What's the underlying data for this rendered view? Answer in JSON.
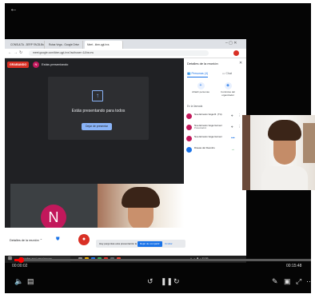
{
  "player": {
    "back_icon": "arrow-back-icon",
    "time_current": "00:00:02",
    "time_total": "00:15:48",
    "progress_fraction": 0.002
  },
  "browser": {
    "tabs": [
      {
        "label": "CONSULTA - 3ERP FACB-Brand.c"
      },
      {
        "label": "Rutas Vega - Google Drive"
      },
      {
        "label": "Meet - kbm-qgt-hvs"
      }
    ],
    "address": "meet.google.com/kbm-qgt-hvs?authuser=1&hs=rw"
  },
  "meet": {
    "recording_badge": "GRABANDO",
    "presenter_initial": "N",
    "presenting_title": "Estás presentando",
    "presenting_card_text": "Estás presentando para todos",
    "stop_presenting_button": "Dejar de presentar",
    "participant_initial": "N",
    "meeting_details_label": "Detalles de la reunión",
    "toast_text": "Hay perguntas esta presentación la pantalla",
    "toast_button": "Dejar de compartir",
    "toast_dismiss": "Ocultar"
  },
  "panel": {
    "title": "Detalles de la reunión",
    "tab_people": "Personas (4)",
    "tab_chat": "Chat",
    "action_add": "Añadir personas",
    "action_present": "Controles del organizador",
    "section_label": "En la llamada",
    "participants": [
      {
        "name": "Noe Ernesto Vega R. (Tú)",
        "role": ""
      },
      {
        "name": "Noe Ernesto Vega Gómez",
        "role": "Presentación"
      },
      {
        "name": "Noe Ernesto Vega Gómez",
        "role": ""
      },
      {
        "name": "Diseas del Desnirio",
        "role": ""
      }
    ]
  },
  "taskbar": {
    "search_placeholder": "Escribe aquí para buscar"
  },
  "colors": {
    "recording_red": "#d93025",
    "accent_blue": "#1a73e8",
    "avatar_pink": "#c2185b",
    "progress_red": "#ff0000"
  }
}
